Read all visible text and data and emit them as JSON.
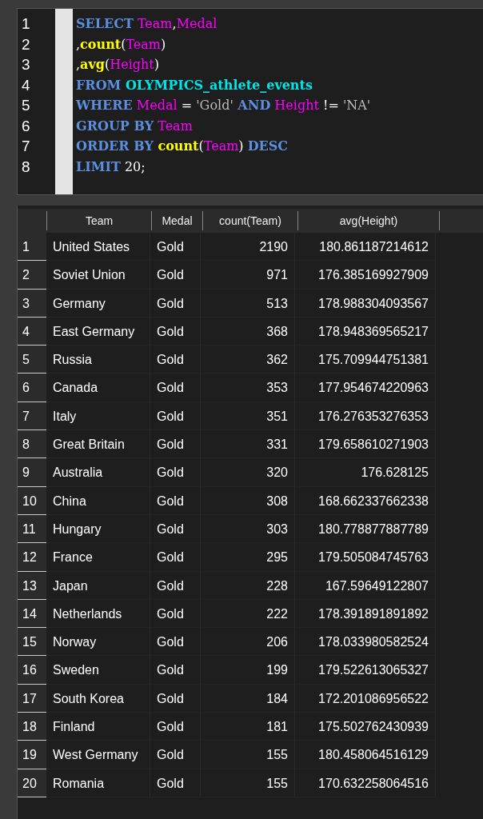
{
  "editor": {
    "lines": [
      {
        "number": "1",
        "tokens": [
          {
            "kind": "keyword",
            "text": "SELECT"
          },
          {
            "kind": "ident",
            "text": " Team"
          },
          {
            "kind": "plain",
            "text": ","
          },
          {
            "kind": "ident",
            "text": "Medal"
          }
        ]
      },
      {
        "number": "2",
        "tokens": [
          {
            "kind": "plain",
            "text": ","
          },
          {
            "kind": "func",
            "text": "count"
          },
          {
            "kind": "plain",
            "text": "("
          },
          {
            "kind": "ident",
            "text": "Team"
          },
          {
            "kind": "plain",
            "text": ")"
          }
        ]
      },
      {
        "number": "3",
        "tokens": [
          {
            "kind": "plain",
            "text": ","
          },
          {
            "kind": "func",
            "text": "avg"
          },
          {
            "kind": "plain",
            "text": "("
          },
          {
            "kind": "ident",
            "text": "Height"
          },
          {
            "kind": "plain",
            "text": ")"
          }
        ]
      },
      {
        "number": "4",
        "tokens": [
          {
            "kind": "keyword",
            "text": "FROM"
          },
          {
            "kind": "table",
            "text": " OLYMPICS_athlete_events"
          }
        ]
      },
      {
        "number": "5",
        "tokens": [
          {
            "kind": "keyword",
            "text": "WHERE"
          },
          {
            "kind": "ident",
            "text": " Medal"
          },
          {
            "kind": "plain",
            "text": " = "
          },
          {
            "kind": "string",
            "text": "'Gold'"
          },
          {
            "kind": "keyword",
            "text": " AND"
          },
          {
            "kind": "ident",
            "text": " Height"
          },
          {
            "kind": "plain",
            "text": " != "
          },
          {
            "kind": "string",
            "text": "'NA'"
          }
        ]
      },
      {
        "number": "6",
        "tokens": [
          {
            "kind": "keyword",
            "text": "GROUP BY"
          },
          {
            "kind": "ident",
            "text": " Team"
          }
        ]
      },
      {
        "number": "7",
        "tokens": [
          {
            "kind": "keyword",
            "text": "ORDER BY"
          },
          {
            "kind": "func",
            "text": " count"
          },
          {
            "kind": "plain",
            "text": "("
          },
          {
            "kind": "ident",
            "text": "Team"
          },
          {
            "kind": "plain",
            "text": ") "
          },
          {
            "kind": "keyword",
            "text": "DESC"
          }
        ]
      },
      {
        "number": "8",
        "tokens": [
          {
            "kind": "keyword",
            "text": "LIMIT"
          },
          {
            "kind": "plain",
            "text": " 20;"
          }
        ]
      }
    ]
  },
  "results": {
    "columns": [
      "Team",
      "Medal",
      "count(Team)",
      "avg(Height)"
    ],
    "rows": [
      {
        "number": "1",
        "cells": [
          "United States",
          "Gold",
          "2190",
          "180.861187214612"
        ]
      },
      {
        "number": "2",
        "cells": [
          "Soviet Union",
          "Gold",
          "971",
          "176.385169927909"
        ]
      },
      {
        "number": "3",
        "cells": [
          "Germany",
          "Gold",
          "513",
          "178.988304093567"
        ]
      },
      {
        "number": "4",
        "cells": [
          "East Germany",
          "Gold",
          "368",
          "178.948369565217"
        ]
      },
      {
        "number": "5",
        "cells": [
          "Russia",
          "Gold",
          "362",
          "175.709944751381"
        ]
      },
      {
        "number": "6",
        "cells": [
          "Canada",
          "Gold",
          "353",
          "177.954674220963"
        ]
      },
      {
        "number": "7",
        "cells": [
          "Italy",
          "Gold",
          "351",
          "176.276353276353"
        ]
      },
      {
        "number": "8",
        "cells": [
          "Great Britain",
          "Gold",
          "331",
          "179.658610271903"
        ]
      },
      {
        "number": "9",
        "cells": [
          "Australia",
          "Gold",
          "320",
          "176.628125"
        ]
      },
      {
        "number": "10",
        "cells": [
          "China",
          "Gold",
          "308",
          "168.662337662338"
        ]
      },
      {
        "number": "11",
        "cells": [
          "Hungary",
          "Gold",
          "303",
          "180.778877887789"
        ]
      },
      {
        "number": "12",
        "cells": [
          "France",
          "Gold",
          "295",
          "179.505084745763"
        ]
      },
      {
        "number": "13",
        "cells": [
          "Japan",
          "Gold",
          "228",
          "167.59649122807"
        ]
      },
      {
        "number": "14",
        "cells": [
          "Netherlands",
          "Gold",
          "222",
          "178.391891891892"
        ]
      },
      {
        "number": "15",
        "cells": [
          "Norway",
          "Gold",
          "206",
          "178.033980582524"
        ]
      },
      {
        "number": "16",
        "cells": [
          "Sweden",
          "Gold",
          "199",
          "179.522613065327"
        ]
      },
      {
        "number": "17",
        "cells": [
          "South Korea",
          "Gold",
          "184",
          "172.201086956522"
        ]
      },
      {
        "number": "18",
        "cells": [
          "Finland",
          "Gold",
          "181",
          "175.502762430939"
        ]
      },
      {
        "number": "19",
        "cells": [
          "West Germany",
          "Gold",
          "155",
          "180.458064516129"
        ]
      },
      {
        "number": "20",
        "cells": [
          "Romania",
          "Gold",
          "155",
          "170.632258064516"
        ]
      }
    ]
  }
}
